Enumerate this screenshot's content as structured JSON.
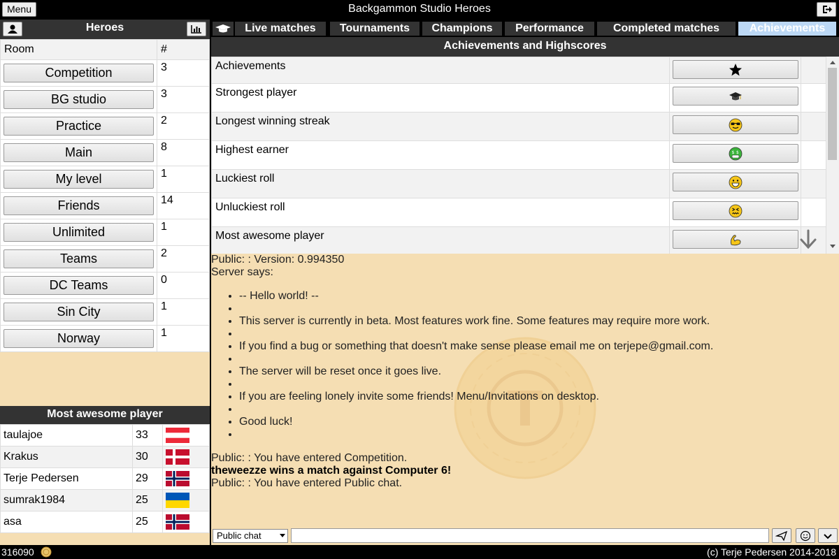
{
  "topbar": {
    "menu_label": "Menu",
    "title": "Backgammon Studio Heroes"
  },
  "left": {
    "title": "Heroes",
    "room_table": {
      "headers": [
        "Room",
        "#"
      ],
      "rows": [
        {
          "room": "Competition",
          "count": "3"
        },
        {
          "room": "BG studio",
          "count": "3"
        },
        {
          "room": "Practice",
          "count": "2"
        },
        {
          "room": "Main",
          "count": "8"
        },
        {
          "room": "My level",
          "count": "1"
        },
        {
          "room": "Friends",
          "count": "14"
        },
        {
          "room": "Unlimited",
          "count": "1"
        },
        {
          "room": "Teams",
          "count": "2"
        },
        {
          "room": "DC Teams",
          "count": "0"
        },
        {
          "room": "Sin City",
          "count": "1"
        },
        {
          "room": "Norway",
          "count": "1"
        }
      ]
    },
    "ranking": {
      "title": "Most awesome player",
      "rows": [
        {
          "name": "taulajoe",
          "score": "33",
          "flag": "austria-flag"
        },
        {
          "name": "Krakus",
          "score": "30",
          "flag": "denmark-flag"
        },
        {
          "name": "Terje Pedersen",
          "score": "29",
          "flag": "norway-flag"
        },
        {
          "name": "sumrak1984",
          "score": "25",
          "flag": "ukraine-flag"
        },
        {
          "name": "asa",
          "score": "25",
          "flag": "norway-flag"
        }
      ]
    }
  },
  "tabs": [
    {
      "label": "Live matches",
      "active": false
    },
    {
      "label": "Tournaments",
      "active": false
    },
    {
      "label": "Champions",
      "active": false
    },
    {
      "label": "Performance",
      "active": false
    },
    {
      "label": "Completed matches",
      "active": false
    },
    {
      "label": "Achievements",
      "active": true
    }
  ],
  "achievements": {
    "title": "Achievements and Highscores",
    "rows": [
      {
        "label": "Achievements",
        "icon": "star-icon"
      },
      {
        "label": "Strongest player",
        "icon": "graduation-cap-icon"
      },
      {
        "label": "Longest winning streak",
        "icon": "sunglasses-face-icon"
      },
      {
        "label": "Highest earner",
        "icon": "money-face-icon"
      },
      {
        "label": "Luckiest roll",
        "icon": "grinning-face-icon"
      },
      {
        "label": "Unluckiest roll",
        "icon": "confounded-face-icon"
      },
      {
        "label": "Most awesome player",
        "icon": "flexed-biceps-icon"
      }
    ]
  },
  "chat": {
    "lines_before": [
      "Public: : Version: 0.994350",
      "Server says:"
    ],
    "bullets": [
      "-- Hello world! --",
      "",
      "This server is currently in beta. Most features work fine. Some features may require more work.",
      "",
      "If you find a bug or something that doesn't make sense please email me on terjepe@gmail.com.",
      "",
      "The server will be reset once it goes live.",
      "",
      "If you are feeling lonely invite some friends! Menu/Invitations on desktop.",
      "",
      "Good luck!",
      ""
    ],
    "lines_after": [
      {
        "text": "Public: : You have entered Competition.",
        "bold": false
      },
      {
        "text": "theweezze wins a match against Computer 6!",
        "bold": true
      },
      {
        "text": "Public: : You have entered Public chat.",
        "bold": false
      }
    ],
    "channel": "Public chat",
    "input_value": ""
  },
  "footer": {
    "coins": "316090",
    "copyright": "(c) Terje Pedersen 2014-2018"
  },
  "colors": {
    "panel_bg": "#f5deb3",
    "header_bg": "#333333",
    "active_tab": "#bcd8f5"
  }
}
